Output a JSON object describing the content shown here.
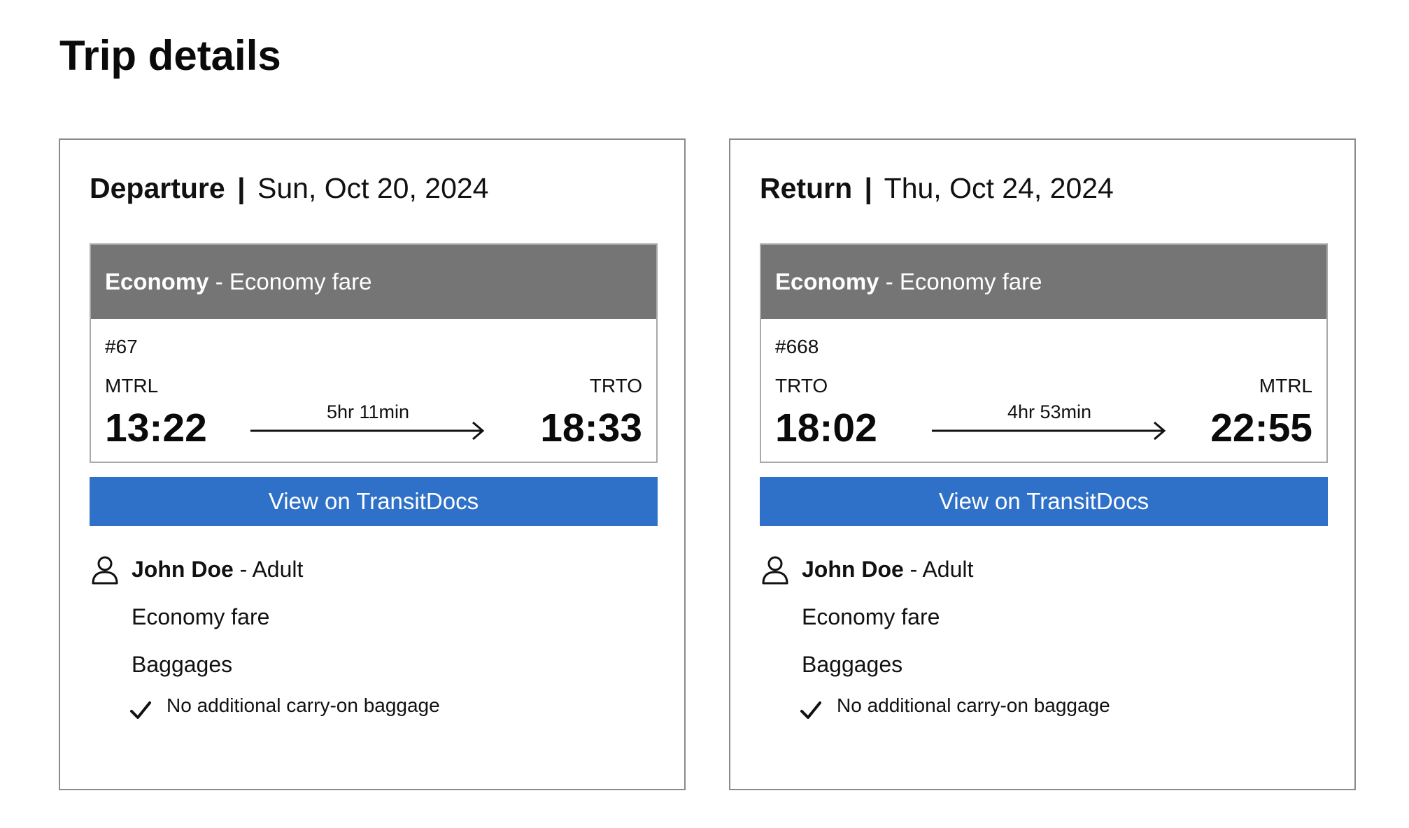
{
  "page": {
    "title": "Trip details"
  },
  "departure": {
    "type": "Departure",
    "separator": "|",
    "date": "Sun, Oct 20, 2024",
    "fare_class": "Economy",
    "fare_dash": "-",
    "fare_name": "Economy fare",
    "trip_number": "#67",
    "origin": "MTRL",
    "destination": "TRTO",
    "depart_time": "13:22",
    "arrive_time": "18:33",
    "duration": "5hr 11min",
    "view_button": "View on TransitDocs",
    "passenger": {
      "name": "John Doe",
      "dash": "-",
      "category": "Adult",
      "fare": "Economy fare",
      "baggage_title": "Baggages",
      "baggage_item": "No additional carry-on baggage"
    }
  },
  "return": {
    "type": "Return",
    "separator": "|",
    "date": "Thu, Oct 24, 2024",
    "fare_class": "Economy",
    "fare_dash": "-",
    "fare_name": "Economy fare",
    "trip_number": "#668",
    "origin": "TRTO",
    "destination": "MTRL",
    "depart_time": "18:02",
    "arrive_time": "22:55",
    "duration": "4hr 53min",
    "view_button": "View on TransitDocs",
    "passenger": {
      "name": "John Doe",
      "dash": "-",
      "category": "Adult",
      "fare": "Economy fare",
      "baggage_title": "Baggages",
      "baggage_item": "No additional carry-on baggage"
    }
  },
  "colors": {
    "fare_bar": "#757575",
    "button": "#2f71c8",
    "card_border": "#8a8a8a"
  },
  "icons": {
    "passenger": "person-icon",
    "arrow": "arrow-right-icon",
    "baggage_check": "checkmark-icon"
  }
}
